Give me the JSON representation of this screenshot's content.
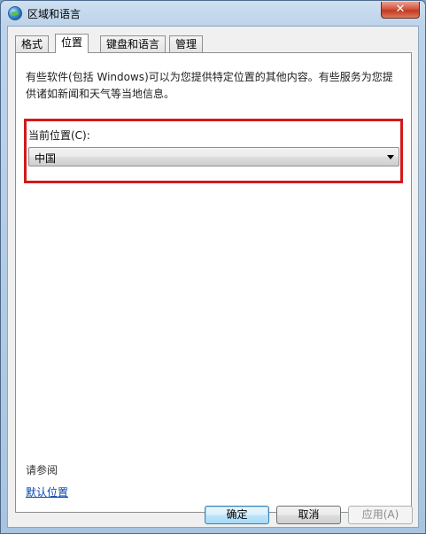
{
  "window": {
    "title": "区域和语言",
    "close_label": "✕"
  },
  "tabs": [
    {
      "label": "格式",
      "active": false
    },
    {
      "label": "位置",
      "active": true
    },
    {
      "label": "键盘和语言",
      "active": false
    },
    {
      "label": "管理",
      "active": false
    }
  ],
  "panel": {
    "description": "有些软件(包括 Windows)可以为您提供特定位置的其他内容。有些服务为您提供诸如新闻和天气等当地信息。",
    "location_label": "当前位置(C):",
    "location_value": "中国",
    "see_also": "请参阅",
    "default_location_link": "默认位置"
  },
  "buttons": {
    "ok": "确定",
    "cancel": "取消",
    "apply": "应用(A)"
  },
  "colors": {
    "highlight_border": "#d11a1a",
    "link": "#0645ad"
  }
}
